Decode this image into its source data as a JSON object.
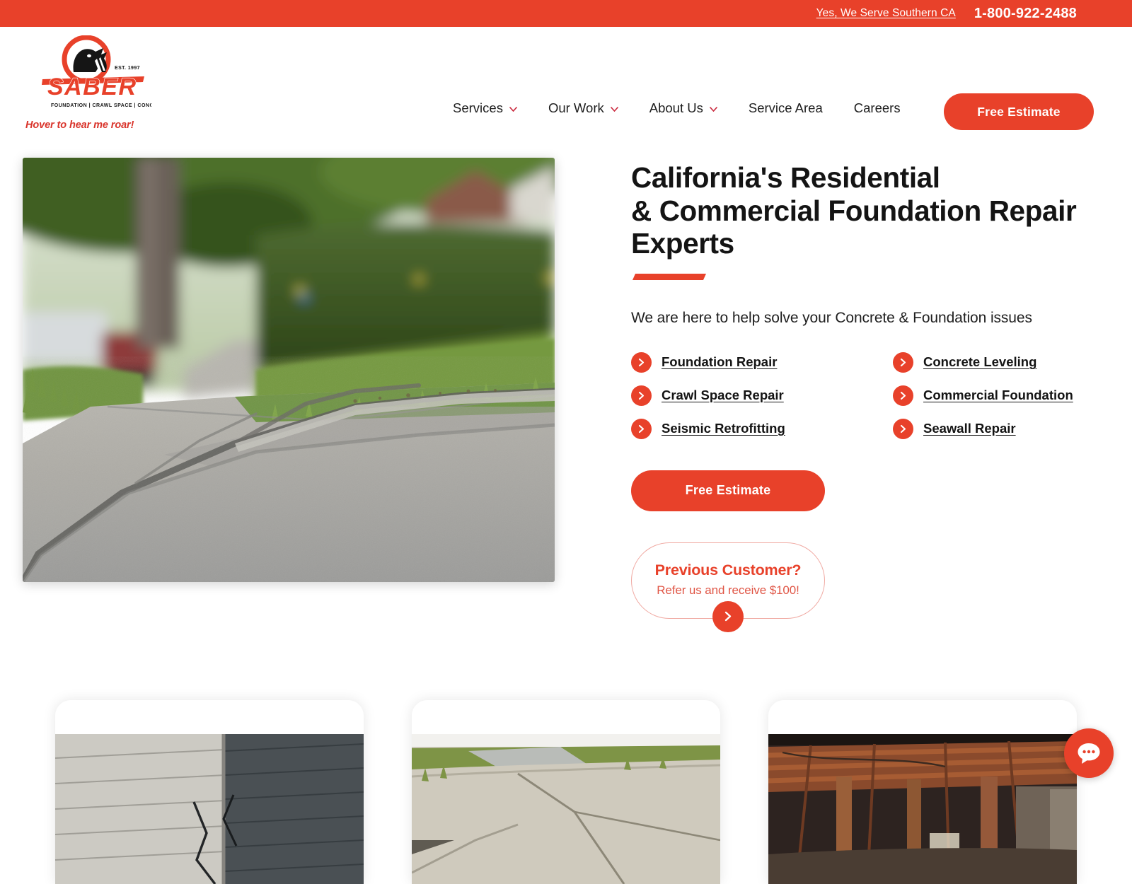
{
  "topbar": {
    "service_link": "Yes, We Serve Southern CA",
    "phone": "1-800-922-2488"
  },
  "brand": {
    "name": "SABER",
    "est": "EST. 1997",
    "tagline": "FOUNDATION | CRAWL SPACE | CONCRETE",
    "hover_note": "Hover to hear me roar!",
    "accent_color": "#E8412A"
  },
  "nav": {
    "items": [
      {
        "label": "Services",
        "has_dropdown": true
      },
      {
        "label": "Our Work",
        "has_dropdown": true
      },
      {
        "label": "About Us",
        "has_dropdown": true
      },
      {
        "label": "Service Area",
        "has_dropdown": false
      },
      {
        "label": "Careers",
        "has_dropdown": false
      }
    ],
    "cta_label": "Free Estimate"
  },
  "hero": {
    "title_line1": "California's Residential",
    "title_line2": "& Commercial Foundation Repair",
    "title_line3": "Experts",
    "subtitle": "We are here to help solve your Concrete & Foundation issues",
    "services": [
      {
        "label": "Foundation Repair"
      },
      {
        "label": "Concrete Leveling"
      },
      {
        "label": "Crawl Space Repair"
      },
      {
        "label": "Commercial Foundation"
      },
      {
        "label": "Seismic Retrofitting"
      },
      {
        "label": "Seawall Repair"
      }
    ],
    "cta_label": "Free Estimate",
    "referral": {
      "title": "Previous Customer?",
      "subtitle": "Refer us and receive $100!",
      "arrow_icon": "chevron-right-icon"
    },
    "image_alt": "Cracked uneven residential sidewalk slab beside green lawn and hedge"
  },
  "cards": [
    {
      "image_alt": "Cracked brick and siding exterior wall of a house"
    },
    {
      "image_alt": "Cracked and settled concrete driveway with grass"
    },
    {
      "image_alt": "Crawl space with wooden floor joists and support posts"
    }
  ],
  "chat": {
    "icon": "chat-bubble-icon",
    "color": "#E8412A"
  }
}
